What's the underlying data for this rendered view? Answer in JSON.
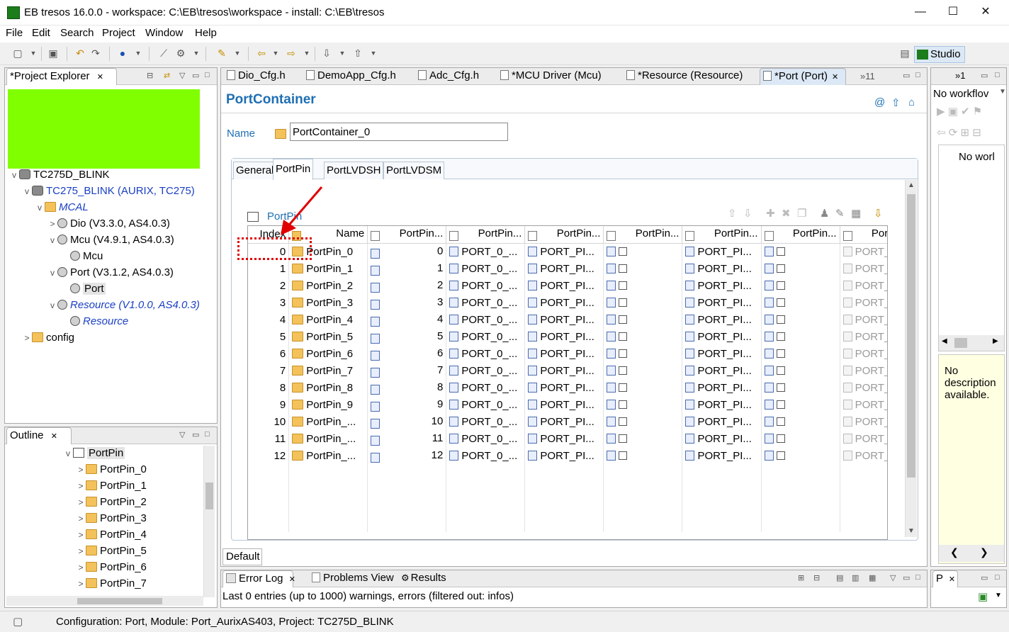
{
  "window": {
    "title": "EB tresos 16.0.0 - workspace: C:\\EB\\tresos\\workspace - install: C:\\EB\\tresos",
    "minimize": "—",
    "maximize": "☐",
    "close": "✕"
  },
  "menu": [
    "File",
    "Edit",
    "Search",
    "Project",
    "Window",
    "Help"
  ],
  "perspective": {
    "label": "Studio"
  },
  "project_explorer": {
    "tab": "*Project Explorer",
    "tree": [
      {
        "label": "TC275D_BLINK",
        "indent": 0,
        "twisty": "v",
        "icon": "project",
        "style": ""
      },
      {
        "label": "TC275_BLINK (AURIX, TC275)",
        "indent": 1,
        "twisty": "v",
        "icon": "chip",
        "style": "blue"
      },
      {
        "label": "MCAL",
        "indent": 2,
        "twisty": "v",
        "icon": "module",
        "style": "blue italic"
      },
      {
        "label": "Dio (V3.3.0, AS4.0.3)",
        "indent": 3,
        "twisty": ">",
        "icon": "gear",
        "style": ""
      },
      {
        "label": "Mcu (V4.9.1, AS4.0.3)",
        "indent": 3,
        "twisty": "v",
        "icon": "gear",
        "style": ""
      },
      {
        "label": "Mcu",
        "indent": 4,
        "twisty": "",
        "icon": "gear",
        "style": ""
      },
      {
        "label": "Port (V3.1.2, AS4.0.3)",
        "indent": 3,
        "twisty": "v",
        "icon": "gear",
        "style": ""
      },
      {
        "label": "Port",
        "indent": 4,
        "twisty": "",
        "icon": "gear",
        "style": "selected"
      },
      {
        "label": "Resource (V1.0.0, AS4.0.3)",
        "indent": 3,
        "twisty": "v",
        "icon": "gear",
        "style": "blue italic"
      },
      {
        "label": "Resource",
        "indent": 4,
        "twisty": "",
        "icon": "gear",
        "style": "blue italic"
      },
      {
        "label": "config",
        "indent": 1,
        "twisty": ">",
        "icon": "folder",
        "style": ""
      }
    ]
  },
  "outline": {
    "tab": "Outline",
    "root": "PortPin",
    "items": [
      "PortPin_0",
      "PortPin_1",
      "PortPin_2",
      "PortPin_3",
      "PortPin_4",
      "PortPin_5",
      "PortPin_6",
      "PortPin_7"
    ]
  },
  "editor_tabs": [
    "Dio_Cfg.h",
    "DemoApp_Cfg.h",
    "Adc_Cfg.h",
    "*MCU Driver (Mcu)",
    "*Resource (Resource)",
    "*Port (Port)"
  ],
  "editor_overflow": "»11",
  "editor": {
    "heading": "PortContainer",
    "name_label": "Name",
    "name_value": "PortContainer_0",
    "subtabs": [
      "General",
      "PortPin",
      "PortLVDSH",
      "PortLVDSM"
    ],
    "active_subtab": "PortPin",
    "table_label": "PortPin",
    "columns": [
      "Index",
      "Name",
      "PortPin...",
      "PortPin...",
      "PortPin...",
      "PortPin...",
      "PortPin...",
      "PortPin...",
      "PortPin...",
      "Po"
    ],
    "rows": [
      {
        "index": "0",
        "name": "PortPin_0",
        "num": "0",
        "c1": "PORT_0_...",
        "c2": "PORT_PI..."
      },
      {
        "index": "1",
        "name": "PortPin_1",
        "num": "1",
        "c1": "PORT_0_...",
        "c2": "PORT_PI..."
      },
      {
        "index": "2",
        "name": "PortPin_2",
        "num": "2",
        "c1": "PORT_0_...",
        "c2": "PORT_PI..."
      },
      {
        "index": "3",
        "name": "PortPin_3",
        "num": "3",
        "c1": "PORT_0_...",
        "c2": "PORT_PI..."
      },
      {
        "index": "4",
        "name": "PortPin_4",
        "num": "4",
        "c1": "PORT_0_...",
        "c2": "PORT_PI..."
      },
      {
        "index": "5",
        "name": "PortPin_5",
        "num": "5",
        "c1": "PORT_0_...",
        "c2": "PORT_PI..."
      },
      {
        "index": "6",
        "name": "PortPin_6",
        "num": "6",
        "c1": "PORT_0_...",
        "c2": "PORT_PI..."
      },
      {
        "index": "7",
        "name": "PortPin_7",
        "num": "7",
        "c1": "PORT_0_...",
        "c2": "PORT_PI..."
      },
      {
        "index": "8",
        "name": "PortPin_8",
        "num": "8",
        "c1": "PORT_0_...",
        "c2": "PORT_PI..."
      },
      {
        "index": "9",
        "name": "PortPin_9",
        "num": "9",
        "c1": "PORT_0_...",
        "c2": "PORT_PI..."
      },
      {
        "index": "10",
        "name": "PortPin_...",
        "num": "10",
        "c1": "PORT_0_...",
        "c2": "PORT_PI..."
      },
      {
        "index": "11",
        "name": "PortPin_...",
        "num": "11",
        "c1": "PORT_0_...",
        "c2": "PORT_PI..."
      },
      {
        "index": "12",
        "name": "PortPin_...",
        "num": "12",
        "c1": "PORT_0_...",
        "c2": "PORT_PI..."
      }
    ],
    "cell_pi": "PORT_PI...",
    "cell_por": "POR",
    "bottom_tab": "Default"
  },
  "right_panel": {
    "tab": "»1",
    "workflow": "No workflov",
    "inner": "No worl",
    "description": "No description available."
  },
  "right_small_tab": "P",
  "bottom": {
    "tabs": [
      "Error Log",
      "Problems View",
      "Results"
    ],
    "message": "Last 0 entries (up to 1000) warnings, errors (filtered out: infos)"
  },
  "status": "Configuration: Port, Module: Port_AurixAS403, Project: TC275D_BLINK",
  "colors": {
    "highlight": "#80ff00",
    "annotation": "#e00000",
    "heading": "#1f6fb3"
  }
}
